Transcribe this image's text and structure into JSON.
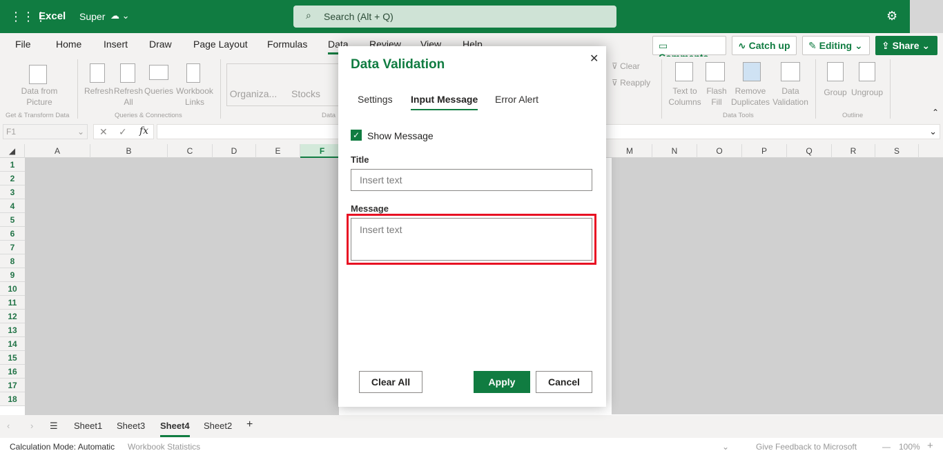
{
  "app": {
    "name": "Excel",
    "document": "Super",
    "search_placeholder": "Search (Alt + Q)"
  },
  "menu_tabs": [
    "File",
    "Home",
    "Insert",
    "Draw",
    "Page Layout",
    "Formulas",
    "Data",
    "Review",
    "View",
    "Help"
  ],
  "active_tab": "Data",
  "top_buttons": {
    "comments": "Comments",
    "catch_up": "Catch up",
    "editing": "Editing",
    "share": "Share"
  },
  "ribbon": {
    "data_from_picture": "Data from Picture",
    "refresh": "Refresh",
    "refresh_all": "Refresh All",
    "queries": "Queries",
    "workbook_links": "Workbook Links",
    "organization": "Organiza...",
    "stocks": "Stocks",
    "clear": "Clear",
    "reapply": "Reapply",
    "text_to_columns": "Text to Columns",
    "flash_fill": "Flash Fill",
    "remove_duplicates": "Remove Duplicates",
    "data_validation": "Data Validation",
    "group": "Group",
    "ungroup": "Ungroup",
    "groups": {
      "get_transform": "Get & Transform Data",
      "queries_connections": "Queries & Connections",
      "data_types": "Data",
      "data_tools": "Data Tools",
      "outline": "Outline"
    }
  },
  "name_box": "F1",
  "columns": [
    "A",
    "B",
    "C",
    "D",
    "E",
    "F",
    "M",
    "N",
    "O",
    "P",
    "Q",
    "R",
    "S"
  ],
  "rows": [
    "1",
    "2",
    "3",
    "4",
    "5",
    "6",
    "7",
    "8",
    "9",
    "10",
    "11",
    "12",
    "13",
    "14",
    "15",
    "16",
    "17",
    "18"
  ],
  "dialog": {
    "title": "Data Validation",
    "tabs": [
      "Settings",
      "Input Message",
      "Error Alert"
    ],
    "active_tab": "Input Message",
    "show_message_label": "Show Message",
    "show_message_checked": true,
    "title_label": "Title",
    "title_placeholder": "Insert text",
    "message_label": "Message",
    "message_placeholder": "Insert text",
    "clear_all": "Clear All",
    "apply": "Apply",
    "cancel": "Cancel"
  },
  "sheets": [
    "Sheet1",
    "Sheet3",
    "Sheet4",
    "Sheet2"
  ],
  "active_sheet": "Sheet4",
  "status": {
    "calc_mode": "Calculation Mode: Automatic",
    "workbook_stats": "Workbook Statistics",
    "feedback": "Give Feedback to Microsoft",
    "zoom": "100%"
  },
  "colors": {
    "brand": "#107c41",
    "highlight": "#e81123"
  }
}
